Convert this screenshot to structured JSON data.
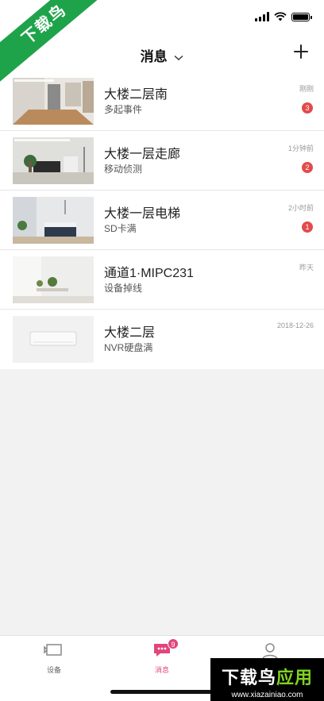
{
  "watermark": {
    "corner_text": "下载鸟",
    "box_text_white": "下载鸟",
    "box_text_green": "应用",
    "box_url": "www.xiazainiao.com"
  },
  "nav": {
    "title": "消息"
  },
  "messages": [
    {
      "title": "大楼二层南",
      "subtitle": "多起事件",
      "time": "刚刚",
      "badge": "3",
      "thumb": "hallway-icon"
    },
    {
      "title": "大楼一层走廊",
      "subtitle": "移动侦测",
      "time": "1分钟前",
      "badge": "2",
      "thumb": "corridor-icon"
    },
    {
      "title": "大楼一层电梯",
      "subtitle": "SD卡满",
      "time": "2小时前",
      "badge": "1",
      "thumb": "bedroom-icon"
    },
    {
      "title": "通道1·MIPC231",
      "subtitle": "设备掉线",
      "time": "昨天",
      "badge": "",
      "thumb": "room-icon"
    },
    {
      "title": "大楼二层",
      "subtitle": "NVR硬盘满",
      "time": "2018-12-26",
      "badge": "",
      "thumb": "air-conditioner-icon"
    }
  ],
  "tabs": [
    {
      "label": "设备",
      "icon": "device-icon",
      "active": false
    },
    {
      "label": "消息",
      "icon": "message-icon",
      "active": true,
      "badge": "9"
    },
    {
      "label": "",
      "icon": "user-icon",
      "active": false
    }
  ],
  "colors": {
    "accent": "#e0457b",
    "badge": "#e34b4b",
    "watermark_green": "#1fa34a"
  }
}
